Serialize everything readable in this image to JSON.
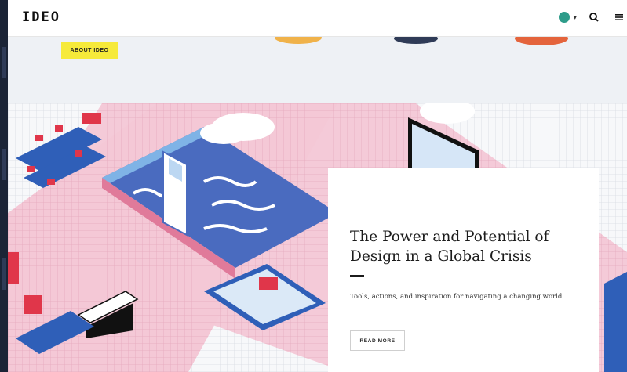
{
  "header": {
    "logo": "IDEO",
    "language_icon": "globe-icon",
    "search_icon": "search-icon",
    "menu_icon": "menu-icon"
  },
  "hero": {
    "badge": "ABOUT IDEO"
  },
  "card": {
    "title": "The Power and Potential of Design in a Global Crisis",
    "description": "Tools, actions, and inspiration for navigating a changing world",
    "button_label": "READ MORE"
  },
  "colors": {
    "badge_bg": "#f6ea3a",
    "floor_pink": "#f2c3d2",
    "pool_blue": "#4a6bbf",
    "accent_red": "#e0364a"
  }
}
